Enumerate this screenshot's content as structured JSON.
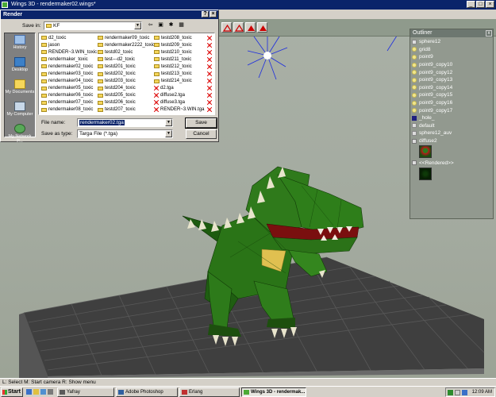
{
  "wings_window": {
    "title": "Wings 3D - rendermaker02.wings*",
    "buttons": [
      "_",
      "□",
      "×"
    ]
  },
  "dialog": {
    "title": "Render",
    "buttons": [
      "?",
      "×"
    ],
    "save_in_label": "Save in:",
    "save_in_value": "KF",
    "places": [
      "History",
      "Desktop",
      "My Documents",
      "My Computer",
      "My Network P..."
    ],
    "files": {
      "col1": [
        "d2_toxic",
        "jason",
        "RENDER~3.WIN_toxic",
        "rendermaker_toxic",
        "rendermaker02_toxic",
        "rendermaker03_toxic",
        "rendermaker04_toxic",
        "rendermaker05_toxic",
        "rendermaker06_toxic",
        "rendermaker07_toxic",
        "rendermaker08_toxic"
      ],
      "col2": [
        "rendermaker09_toxic",
        "rendermaker2222_toxic",
        "testd02_toxic",
        "test---d2_toxic",
        "testd201_toxic",
        "testd202_toxic",
        "testd203_toxic",
        "testd204_toxic",
        "testd205_toxic",
        "testd206_toxic",
        "testd207_toxic"
      ],
      "col3": [
        "testd208_toxic",
        "testd209_toxic",
        "testd210_toxic",
        "testd211_toxic",
        "testd212_toxic",
        "testd213_toxic",
        "testd214_toxic",
        "d2.tga",
        "diffuse2.tga",
        "diffuse3.tga",
        "RENDER~3.WIN.tga"
      ],
      "col3_types": [
        "folder",
        "folder",
        "folder",
        "folder",
        "folder",
        "folder",
        "folder",
        "tga",
        "tga",
        "tga",
        "tga"
      ]
    },
    "file_name_label": "File name:",
    "file_name_value": "rendermaker02.tga",
    "save_type_label": "Save as type:",
    "save_type_value": "Targa File (*.tga)",
    "save_button": "Save",
    "cancel_button": "Cancel"
  },
  "outliner": {
    "title": "Outliner",
    "close": "x",
    "items": [
      {
        "label": "sphere12",
        "icon": "object"
      },
      {
        "label": "grid8",
        "icon": "material"
      },
      {
        "label": "point9",
        "icon": "material"
      },
      {
        "label": "point9_copy10",
        "icon": "material"
      },
      {
        "label": "point9_copy12",
        "icon": "material"
      },
      {
        "label": "point9_copy13",
        "icon": "material"
      },
      {
        "label": "point9_copy14",
        "icon": "material"
      },
      {
        "label": "point9_copy15",
        "icon": "material"
      },
      {
        "label": "point9_copy16",
        "icon": "material"
      },
      {
        "label": "point9_copy17",
        "icon": "material"
      },
      {
        "label": "_hole_",
        "icon": "hole"
      },
      {
        "label": "default",
        "icon": "object"
      },
      {
        "label": "sphere12_auv",
        "icon": "object"
      },
      {
        "label": "diffuse2",
        "icon": "image"
      }
    ],
    "rendered_label": "<<Rendered>>"
  },
  "statusbar": {
    "text": "L: Select   M: Start camera   R: Show menu"
  },
  "taskbar": {
    "start_label": "Start",
    "tasks": [
      "Yafray",
      "Adobe Photoshop",
      "Erlang",
      "Wings 3D - rendermak..."
    ],
    "clock": "12:09 AM"
  }
}
